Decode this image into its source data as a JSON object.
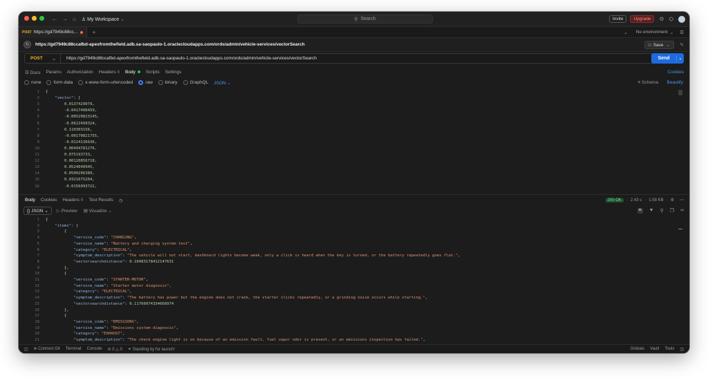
{
  "titlebar": {
    "workspace": "My Workspace",
    "search_placeholder": "Search",
    "invite": "Invite",
    "upgrade": "Upgrade"
  },
  "tabs": {
    "active_method": "POST",
    "active_label": "https://gd7949c88cc...",
    "environment": "No environment"
  },
  "request": {
    "title_url": "https://gd7949c88ccafbd-apexfromthefield.adb.sa-saopaulo-1.oraclecloudapps.com/ords/admin/vehicle-services/vectorSearch",
    "save_label": "Save",
    "method": "POST",
    "url": "https://gd7949c88ccafbd-apexfromthefield.adb.sa-saopaulo-1.oraclecloudapps.com/ords/admin/vehicle-services/vectorSearch",
    "send_label": "Send",
    "tabs": [
      "Docs",
      "Params",
      "Authorization",
      "Headers",
      "Body",
      "Scripts",
      "Settings"
    ],
    "headers_count": "8",
    "cookies_label": "Cookies",
    "body_types": [
      "none",
      "form-data",
      "x-www-form-urlencoded",
      "raw",
      "binary",
      "GraphQL"
    ],
    "body_format": "JSON",
    "schema_label": "Schema",
    "beautify_label": "Beautify"
  },
  "request_body": {
    "line_numbers": [
      "1",
      "2",
      "3",
      "4",
      "5",
      "6",
      "7",
      "8",
      "9",
      "10",
      "11",
      "12",
      "13",
      "14",
      "15",
      "16"
    ],
    "lines": [
      "{",
      "    \"vector\": [",
      "        0.0137429079,",
      "        -0.0417408459,",
      "        -0.00520823145,",
      "        -0.0622499324,",
      "        0.110303156,",
      "        -0.00170821755,",
      "        -0.0224136636,",
      "        0.00494781276,",
      "        0.075193733,",
      "        0.00120856718,",
      "        0.0524040945,",
      "        0.0500206389,",
      "        0.0321675204,",
      "        -0.0156093722,"
    ]
  },
  "response": {
    "tabs": [
      "Body",
      "Cookies",
      "Headers",
      "Test Results"
    ],
    "headers_count": "6",
    "status": "200 OK",
    "time": "2.43 s",
    "size": "1.58 KB",
    "format": "JSON",
    "preview_label": "Preview",
    "visualize_label": "Visualize"
  },
  "response_body": {
    "line_numbers": [
      "1",
      "2",
      "3",
      "4",
      "5",
      "6",
      "7",
      "8",
      "9",
      "10",
      "11",
      "12",
      "13",
      "14",
      "15",
      "16",
      "17",
      "18",
      "19",
      "20",
      "21"
    ],
    "lines": [
      "{",
      "    \"items\": [",
      "        {",
      "            \"service_code\": \"CHARGING\",",
      "            \"service_name\": \"Battery and charging system test\",",
      "            \"category\": \"ELECTRICAL\",",
      "            \"symptom_description\": \"The vehicle will not start, dashboard lights become weak, only a click is heard when the key is turned, or the battery repeatedly goes flat.\",",
      "            \"vectorsearchdistance\": 0.10483178412147631",
      "        },",
      "        {",
      "            \"service_code\": \"STARTER-MOTOR\",",
      "            \"service_name\": \"Starter motor diagnosis\",",
      "            \"category\": \"ELECTRICAL\",",
      "            \"symptom_description\": \"The battery has power but the engine does not crank, the starter clicks repeatedly, or a grinding noise occurs while starting.\",",
      "            \"vectorsearchdistance\": 0.11766074334668974",
      "        },",
      "        {",
      "            \"service_code\": \"EMISSIONS\",",
      "            \"service_name\": \"Emissions system diagnosis\",",
      "            \"category\": \"EXHAUST\",",
      "            \"symptom_description\": \"The check engine light is on because of an emission fault, fuel vapor odor is present, or an emissions inspection has failed.\","
    ]
  },
  "statusbar": {
    "connect": "Connect Git",
    "terminal": "Terminal",
    "console": "Console",
    "errors": "0",
    "warnings": "0",
    "standing_by": "Standing by for launch!",
    "globals": "Globals",
    "vault": "Vault",
    "tools": "Tools"
  },
  "colors": {
    "accent": "#1e6be0",
    "method_post": "#f0b429",
    "status_ok": "#6fe08f"
  }
}
